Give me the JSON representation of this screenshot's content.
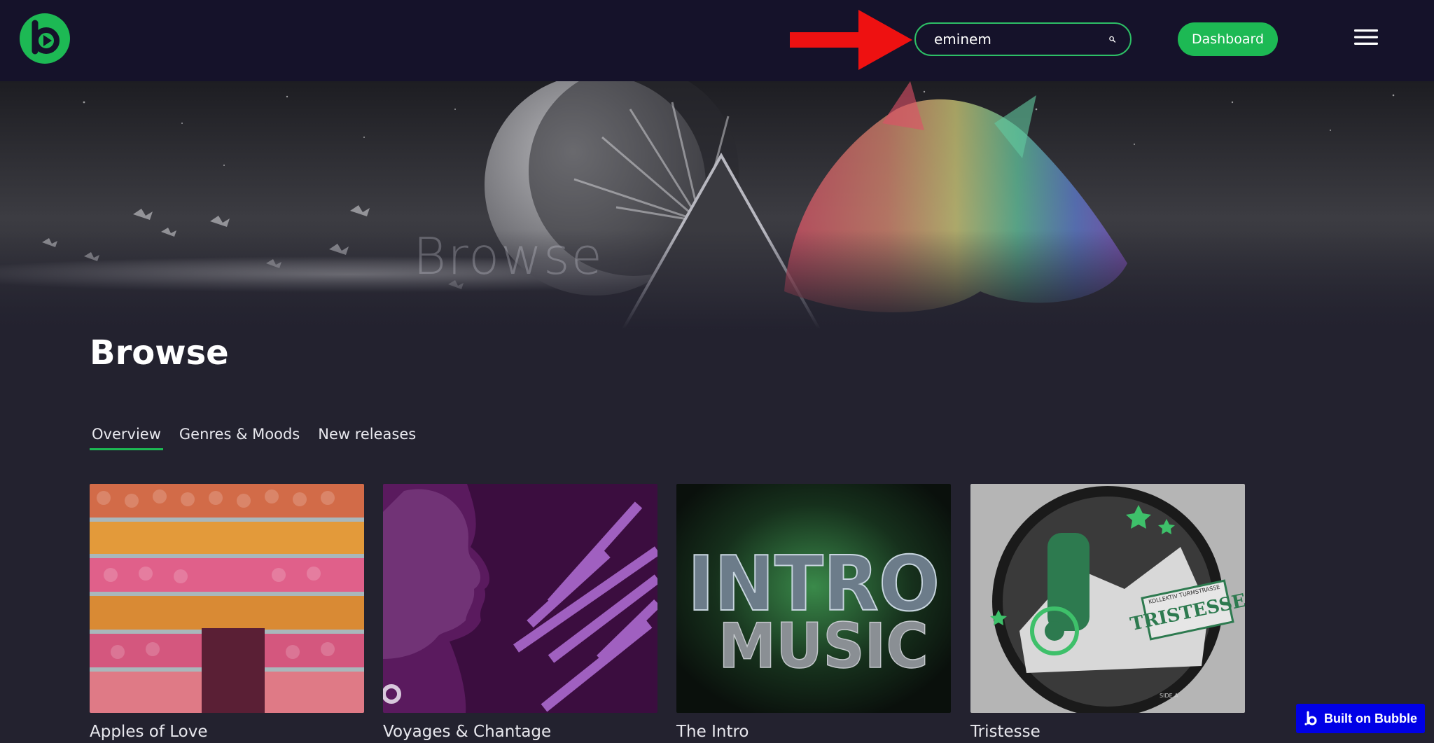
{
  "header": {
    "search": {
      "value": "eminem",
      "placeholder": ""
    },
    "dashboard_label": "Dashboard"
  },
  "hero": {
    "title": "Browse"
  },
  "page": {
    "title": "Browse"
  },
  "tabs": [
    {
      "label": "Overview",
      "active": true
    },
    {
      "label": "Genres & Moods",
      "active": false
    },
    {
      "label": "New releases",
      "active": false
    }
  ],
  "cards": [
    {
      "label": "Apples of Love"
    },
    {
      "label": "Voyages & Chantage"
    },
    {
      "label": "The Intro",
      "art_text": [
        "INTRO",
        "MUSIC"
      ]
    },
    {
      "label": "Tristesse",
      "art_text": [
        "TRISTESSE",
        "KOLLEKTIV TURMSTRASSE",
        "SIDE A"
      ]
    }
  ],
  "badge": {
    "label": "Built on Bubble"
  },
  "colors": {
    "topbar": "#15122a",
    "page_bg": "#23222f",
    "accent": "#1db954",
    "annotation_arrow": "#ee1111",
    "badge_bg": "#0000e6"
  },
  "icons": {
    "logo": "bubble-play-logo",
    "search": "search-icon",
    "menu": "hamburger-menu-icon",
    "annotation": "red-arrow-icon"
  }
}
